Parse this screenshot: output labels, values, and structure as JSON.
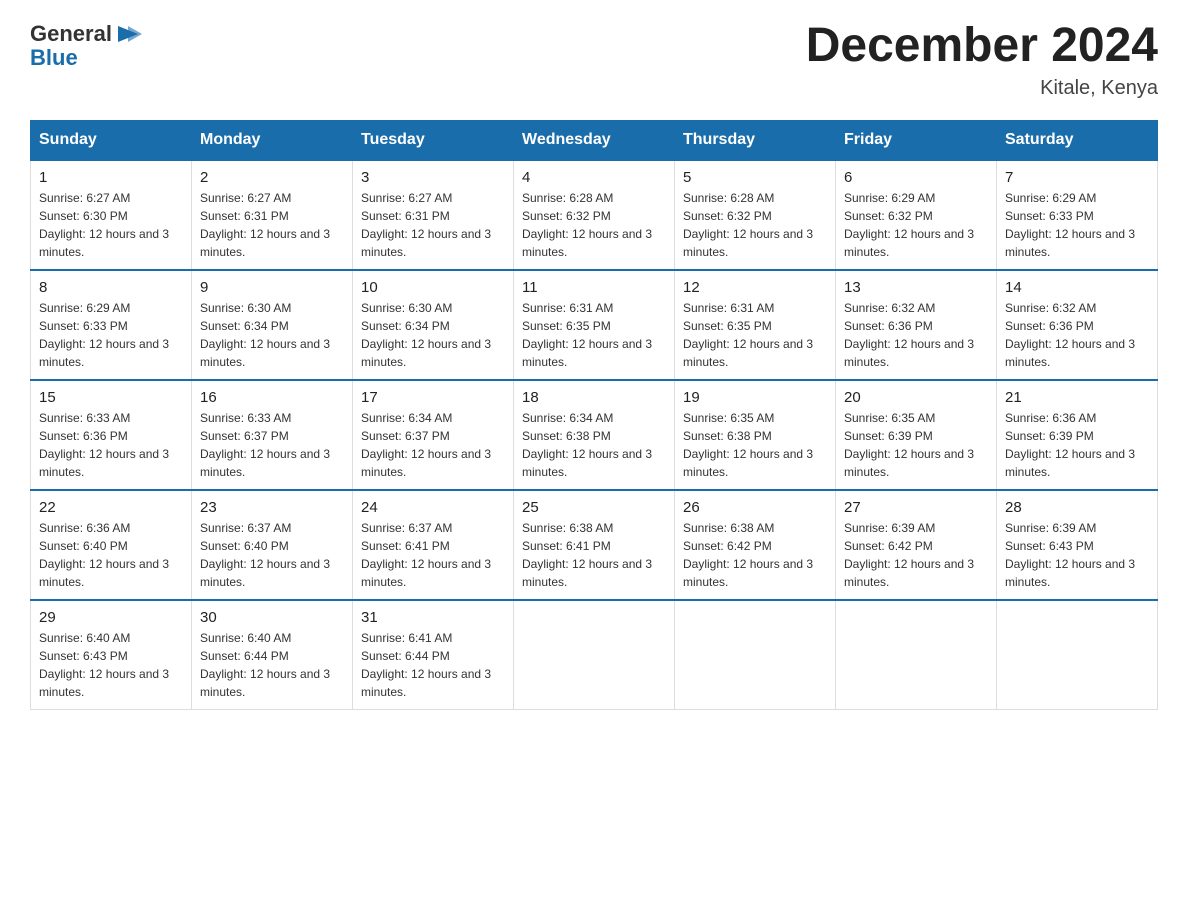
{
  "header": {
    "logo_line1": "General",
    "logo_line2": "Blue",
    "title": "December 2024",
    "subtitle": "Kitale, Kenya"
  },
  "weekdays": [
    "Sunday",
    "Monday",
    "Tuesday",
    "Wednesday",
    "Thursday",
    "Friday",
    "Saturday"
  ],
  "weeks": [
    [
      {
        "day": "1",
        "sunrise": "6:27 AM",
        "sunset": "6:30 PM",
        "daylight": "12 hours and 3 minutes."
      },
      {
        "day": "2",
        "sunrise": "6:27 AM",
        "sunset": "6:31 PM",
        "daylight": "12 hours and 3 minutes."
      },
      {
        "day": "3",
        "sunrise": "6:27 AM",
        "sunset": "6:31 PM",
        "daylight": "12 hours and 3 minutes."
      },
      {
        "day": "4",
        "sunrise": "6:28 AM",
        "sunset": "6:32 PM",
        "daylight": "12 hours and 3 minutes."
      },
      {
        "day": "5",
        "sunrise": "6:28 AM",
        "sunset": "6:32 PM",
        "daylight": "12 hours and 3 minutes."
      },
      {
        "day": "6",
        "sunrise": "6:29 AM",
        "sunset": "6:32 PM",
        "daylight": "12 hours and 3 minutes."
      },
      {
        "day": "7",
        "sunrise": "6:29 AM",
        "sunset": "6:33 PM",
        "daylight": "12 hours and 3 minutes."
      }
    ],
    [
      {
        "day": "8",
        "sunrise": "6:29 AM",
        "sunset": "6:33 PM",
        "daylight": "12 hours and 3 minutes."
      },
      {
        "day": "9",
        "sunrise": "6:30 AM",
        "sunset": "6:34 PM",
        "daylight": "12 hours and 3 minutes."
      },
      {
        "day": "10",
        "sunrise": "6:30 AM",
        "sunset": "6:34 PM",
        "daylight": "12 hours and 3 minutes."
      },
      {
        "day": "11",
        "sunrise": "6:31 AM",
        "sunset": "6:35 PM",
        "daylight": "12 hours and 3 minutes."
      },
      {
        "day": "12",
        "sunrise": "6:31 AM",
        "sunset": "6:35 PM",
        "daylight": "12 hours and 3 minutes."
      },
      {
        "day": "13",
        "sunrise": "6:32 AM",
        "sunset": "6:36 PM",
        "daylight": "12 hours and 3 minutes."
      },
      {
        "day": "14",
        "sunrise": "6:32 AM",
        "sunset": "6:36 PM",
        "daylight": "12 hours and 3 minutes."
      }
    ],
    [
      {
        "day": "15",
        "sunrise": "6:33 AM",
        "sunset": "6:36 PM",
        "daylight": "12 hours and 3 minutes."
      },
      {
        "day": "16",
        "sunrise": "6:33 AM",
        "sunset": "6:37 PM",
        "daylight": "12 hours and 3 minutes."
      },
      {
        "day": "17",
        "sunrise": "6:34 AM",
        "sunset": "6:37 PM",
        "daylight": "12 hours and 3 minutes."
      },
      {
        "day": "18",
        "sunrise": "6:34 AM",
        "sunset": "6:38 PM",
        "daylight": "12 hours and 3 minutes."
      },
      {
        "day": "19",
        "sunrise": "6:35 AM",
        "sunset": "6:38 PM",
        "daylight": "12 hours and 3 minutes."
      },
      {
        "day": "20",
        "sunrise": "6:35 AM",
        "sunset": "6:39 PM",
        "daylight": "12 hours and 3 minutes."
      },
      {
        "day": "21",
        "sunrise": "6:36 AM",
        "sunset": "6:39 PM",
        "daylight": "12 hours and 3 minutes."
      }
    ],
    [
      {
        "day": "22",
        "sunrise": "6:36 AM",
        "sunset": "6:40 PM",
        "daylight": "12 hours and 3 minutes."
      },
      {
        "day": "23",
        "sunrise": "6:37 AM",
        "sunset": "6:40 PM",
        "daylight": "12 hours and 3 minutes."
      },
      {
        "day": "24",
        "sunrise": "6:37 AM",
        "sunset": "6:41 PM",
        "daylight": "12 hours and 3 minutes."
      },
      {
        "day": "25",
        "sunrise": "6:38 AM",
        "sunset": "6:41 PM",
        "daylight": "12 hours and 3 minutes."
      },
      {
        "day": "26",
        "sunrise": "6:38 AM",
        "sunset": "6:42 PM",
        "daylight": "12 hours and 3 minutes."
      },
      {
        "day": "27",
        "sunrise": "6:39 AM",
        "sunset": "6:42 PM",
        "daylight": "12 hours and 3 minutes."
      },
      {
        "day": "28",
        "sunrise": "6:39 AM",
        "sunset": "6:43 PM",
        "daylight": "12 hours and 3 minutes."
      }
    ],
    [
      {
        "day": "29",
        "sunrise": "6:40 AM",
        "sunset": "6:43 PM",
        "daylight": "12 hours and 3 minutes."
      },
      {
        "day": "30",
        "sunrise": "6:40 AM",
        "sunset": "6:44 PM",
        "daylight": "12 hours and 3 minutes."
      },
      {
        "day": "31",
        "sunrise": "6:41 AM",
        "sunset": "6:44 PM",
        "daylight": "12 hours and 3 minutes."
      },
      null,
      null,
      null,
      null
    ]
  ]
}
